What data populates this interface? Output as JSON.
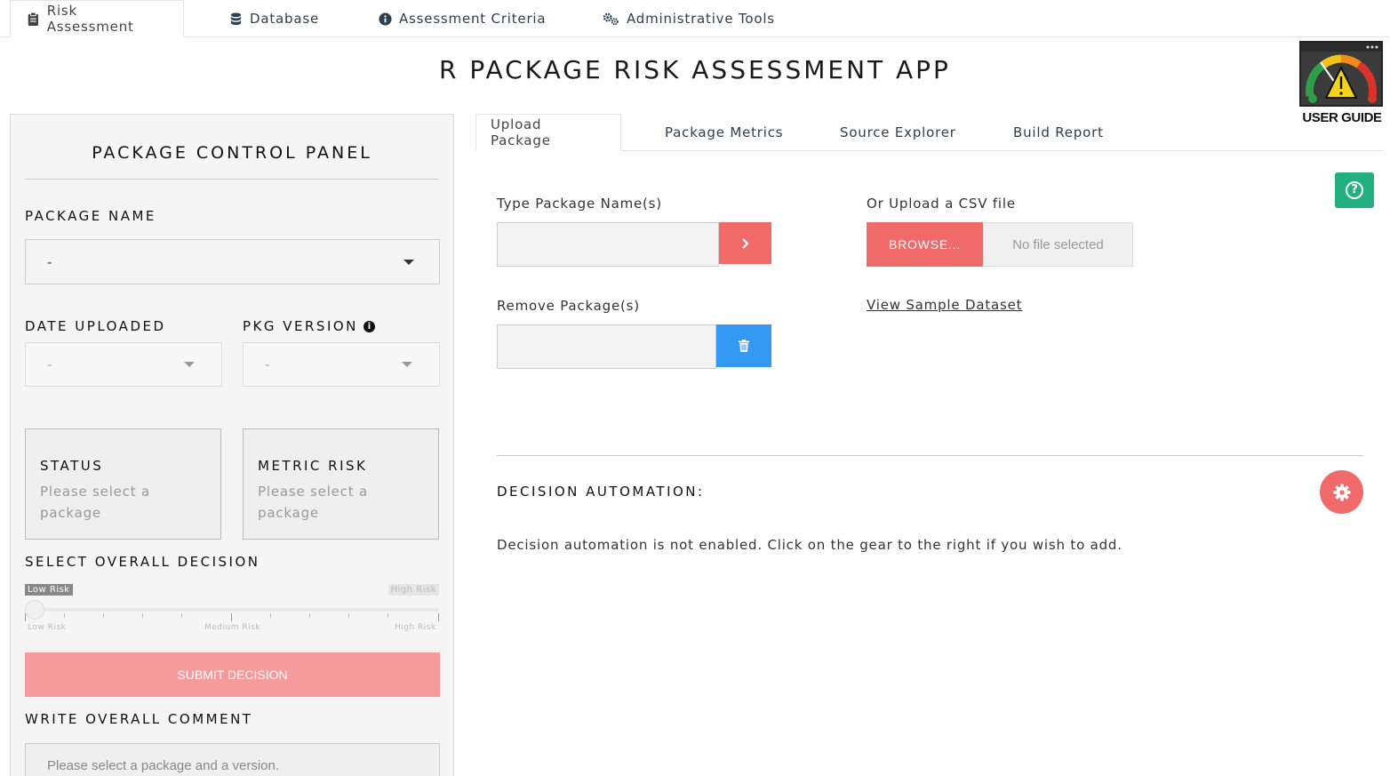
{
  "nav": {
    "tabs": [
      {
        "label": "Risk Assessment",
        "icon": "clipboard-icon"
      },
      {
        "label": "Database",
        "icon": "database-icon"
      },
      {
        "label": "Assessment Criteria",
        "icon": "info-circle-icon"
      },
      {
        "label": "Administrative Tools",
        "icon": "cogs-icon"
      }
    ],
    "active_tab": "Risk Assessment"
  },
  "app_title": "R PACKAGE RISK ASSESSMENT APP",
  "user_guide": {
    "label": "USER GUIDE"
  },
  "control_panel": {
    "title": "PACKAGE CONTROL PANEL",
    "package_name_label": "PACKAGE NAME",
    "package_name_value": "-",
    "date_uploaded_label": "DATE UPLOADED",
    "date_uploaded_value": "-",
    "pkg_version_label": "PKG VERSION",
    "pkg_version_value": "-",
    "status": {
      "title": "STATUS",
      "text": "Please select a package"
    },
    "metric_risk": {
      "title": "METRIC RISK",
      "text": "Please select a package"
    },
    "decision_label": "SELECT OVERALL DECISION",
    "slider": {
      "selected": "Low Risk",
      "max_tag": "High Risk",
      "ticks": [
        "Low Risk",
        "Medium Risk",
        "High Risk"
      ],
      "value": 0
    },
    "submit_label": "SUBMIT DECISION",
    "comment_label": "WRITE OVERALL COMMENT",
    "comment_placeholder": "Please select a package and a version."
  },
  "sub_nav": {
    "tabs": [
      "Upload Package",
      "Package Metrics",
      "Source Explorer",
      "Build Report"
    ],
    "active_tab": "Upload Package"
  },
  "upload": {
    "type_label": "Type Package Name(s)",
    "type_value": "",
    "remove_label": "Remove Package(s)",
    "remove_value": "",
    "csv_label": "Or Upload a CSV file",
    "browse_label": "BROWSE...",
    "file_status": "No file selected",
    "sample_link": "View Sample Dataset"
  },
  "decision_automation": {
    "title": "DECISION AUTOMATION:",
    "text": "Decision automation is not enabled. Click on the gear to the right if you wish to add."
  },
  "colors": {
    "accent_red": "#f06a6a",
    "submit_disabled": "#f59b9b",
    "blue": "#3399f3",
    "green": "#23b080"
  }
}
